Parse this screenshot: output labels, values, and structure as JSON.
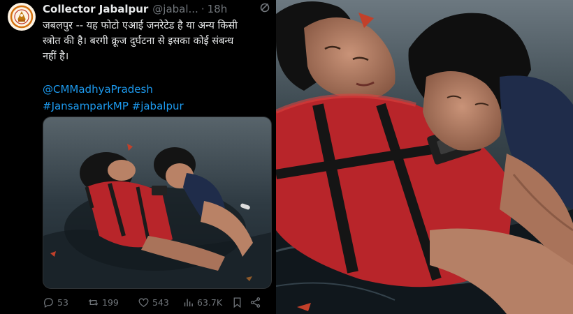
{
  "tweet": {
    "display_name": "Collector Jabalpur",
    "handle": "@jabal...",
    "time": "18h",
    "text_lines": [
      "जबलपुर -- यह फोटो एआई जनरेटेड है या अन्य किसी",
      "स्त्रोत की है। बरगी क्रूज दुर्घटना से इसका कोई संबन्ध",
      "नहीं है।"
    ],
    "links": [
      "@CMMadhyaPradesh",
      "#JansamparkMP #jabalpur"
    ],
    "stats": {
      "replies": "53",
      "retweets": "199",
      "likes": "543",
      "views": "63.7K"
    }
  },
  "colors": {
    "background": "#000000",
    "text": "#e7e9ea",
    "muted": "#71767b",
    "link": "#1d9bf0",
    "life_jacket": "#b8252a"
  },
  "icons": [
    "government-emblem-icon",
    "slashed-circle-icon",
    "reply-icon",
    "retweet-icon",
    "like-icon",
    "views-icon",
    "bookmark-icon",
    "share-icon"
  ]
}
